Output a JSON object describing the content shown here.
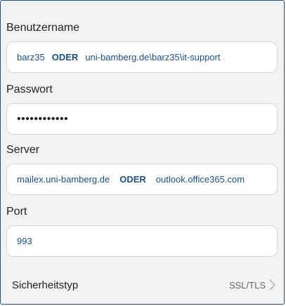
{
  "username": {
    "label": "Benutzername",
    "value_a": "barz35",
    "or": "ODER",
    "value_b": "uni-bamberg.de\\barz35\\it-support"
  },
  "password": {
    "label": "Passwort",
    "value": "••••••••••••"
  },
  "server": {
    "label": "Server",
    "value_a": "mailex.uni-bamberg.de",
    "or": "ODER",
    "value_b": "outlook.office365.com"
  },
  "port": {
    "label": "Port",
    "value": "993"
  },
  "security": {
    "label": "Sicherheitstyp",
    "value": "SSL/TLS",
    "chevron_icon": "chevron-right-icon"
  },
  "colors": {
    "accent": "#1a4f88",
    "background": "#f3f3f3",
    "field": "#ffffff"
  }
}
